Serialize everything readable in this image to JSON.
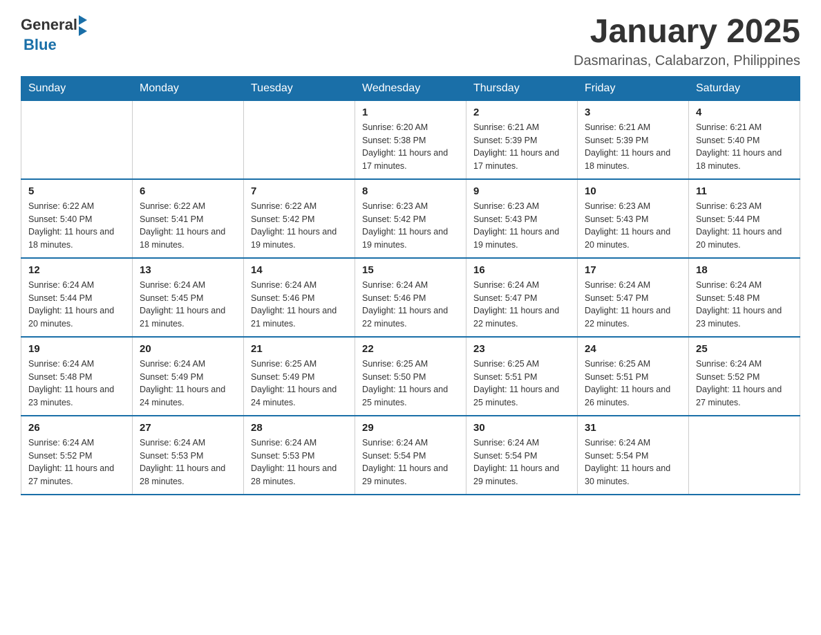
{
  "header": {
    "logo": {
      "general": "General",
      "blue": "Blue"
    },
    "title": "January 2025",
    "location": "Dasmarinas, Calabarzon, Philippines"
  },
  "days_of_week": [
    "Sunday",
    "Monday",
    "Tuesday",
    "Wednesday",
    "Thursday",
    "Friday",
    "Saturday"
  ],
  "weeks": [
    [
      {
        "day": "",
        "info": ""
      },
      {
        "day": "",
        "info": ""
      },
      {
        "day": "",
        "info": ""
      },
      {
        "day": "1",
        "info": "Sunrise: 6:20 AM\nSunset: 5:38 PM\nDaylight: 11 hours and 17 minutes."
      },
      {
        "day": "2",
        "info": "Sunrise: 6:21 AM\nSunset: 5:39 PM\nDaylight: 11 hours and 17 minutes."
      },
      {
        "day": "3",
        "info": "Sunrise: 6:21 AM\nSunset: 5:39 PM\nDaylight: 11 hours and 18 minutes."
      },
      {
        "day": "4",
        "info": "Sunrise: 6:21 AM\nSunset: 5:40 PM\nDaylight: 11 hours and 18 minutes."
      }
    ],
    [
      {
        "day": "5",
        "info": "Sunrise: 6:22 AM\nSunset: 5:40 PM\nDaylight: 11 hours and 18 minutes."
      },
      {
        "day": "6",
        "info": "Sunrise: 6:22 AM\nSunset: 5:41 PM\nDaylight: 11 hours and 18 minutes."
      },
      {
        "day": "7",
        "info": "Sunrise: 6:22 AM\nSunset: 5:42 PM\nDaylight: 11 hours and 19 minutes."
      },
      {
        "day": "8",
        "info": "Sunrise: 6:23 AM\nSunset: 5:42 PM\nDaylight: 11 hours and 19 minutes."
      },
      {
        "day": "9",
        "info": "Sunrise: 6:23 AM\nSunset: 5:43 PM\nDaylight: 11 hours and 19 minutes."
      },
      {
        "day": "10",
        "info": "Sunrise: 6:23 AM\nSunset: 5:43 PM\nDaylight: 11 hours and 20 minutes."
      },
      {
        "day": "11",
        "info": "Sunrise: 6:23 AM\nSunset: 5:44 PM\nDaylight: 11 hours and 20 minutes."
      }
    ],
    [
      {
        "day": "12",
        "info": "Sunrise: 6:24 AM\nSunset: 5:44 PM\nDaylight: 11 hours and 20 minutes."
      },
      {
        "day": "13",
        "info": "Sunrise: 6:24 AM\nSunset: 5:45 PM\nDaylight: 11 hours and 21 minutes."
      },
      {
        "day": "14",
        "info": "Sunrise: 6:24 AM\nSunset: 5:46 PM\nDaylight: 11 hours and 21 minutes."
      },
      {
        "day": "15",
        "info": "Sunrise: 6:24 AM\nSunset: 5:46 PM\nDaylight: 11 hours and 22 minutes."
      },
      {
        "day": "16",
        "info": "Sunrise: 6:24 AM\nSunset: 5:47 PM\nDaylight: 11 hours and 22 minutes."
      },
      {
        "day": "17",
        "info": "Sunrise: 6:24 AM\nSunset: 5:47 PM\nDaylight: 11 hours and 22 minutes."
      },
      {
        "day": "18",
        "info": "Sunrise: 6:24 AM\nSunset: 5:48 PM\nDaylight: 11 hours and 23 minutes."
      }
    ],
    [
      {
        "day": "19",
        "info": "Sunrise: 6:24 AM\nSunset: 5:48 PM\nDaylight: 11 hours and 23 minutes."
      },
      {
        "day": "20",
        "info": "Sunrise: 6:24 AM\nSunset: 5:49 PM\nDaylight: 11 hours and 24 minutes."
      },
      {
        "day": "21",
        "info": "Sunrise: 6:25 AM\nSunset: 5:49 PM\nDaylight: 11 hours and 24 minutes."
      },
      {
        "day": "22",
        "info": "Sunrise: 6:25 AM\nSunset: 5:50 PM\nDaylight: 11 hours and 25 minutes."
      },
      {
        "day": "23",
        "info": "Sunrise: 6:25 AM\nSunset: 5:51 PM\nDaylight: 11 hours and 25 minutes."
      },
      {
        "day": "24",
        "info": "Sunrise: 6:25 AM\nSunset: 5:51 PM\nDaylight: 11 hours and 26 minutes."
      },
      {
        "day": "25",
        "info": "Sunrise: 6:24 AM\nSunset: 5:52 PM\nDaylight: 11 hours and 27 minutes."
      }
    ],
    [
      {
        "day": "26",
        "info": "Sunrise: 6:24 AM\nSunset: 5:52 PM\nDaylight: 11 hours and 27 minutes."
      },
      {
        "day": "27",
        "info": "Sunrise: 6:24 AM\nSunset: 5:53 PM\nDaylight: 11 hours and 28 minutes."
      },
      {
        "day": "28",
        "info": "Sunrise: 6:24 AM\nSunset: 5:53 PM\nDaylight: 11 hours and 28 minutes."
      },
      {
        "day": "29",
        "info": "Sunrise: 6:24 AM\nSunset: 5:54 PM\nDaylight: 11 hours and 29 minutes."
      },
      {
        "day": "30",
        "info": "Sunrise: 6:24 AM\nSunset: 5:54 PM\nDaylight: 11 hours and 29 minutes."
      },
      {
        "day": "31",
        "info": "Sunrise: 6:24 AM\nSunset: 5:54 PM\nDaylight: 11 hours and 30 minutes."
      },
      {
        "day": "",
        "info": ""
      }
    ]
  ]
}
